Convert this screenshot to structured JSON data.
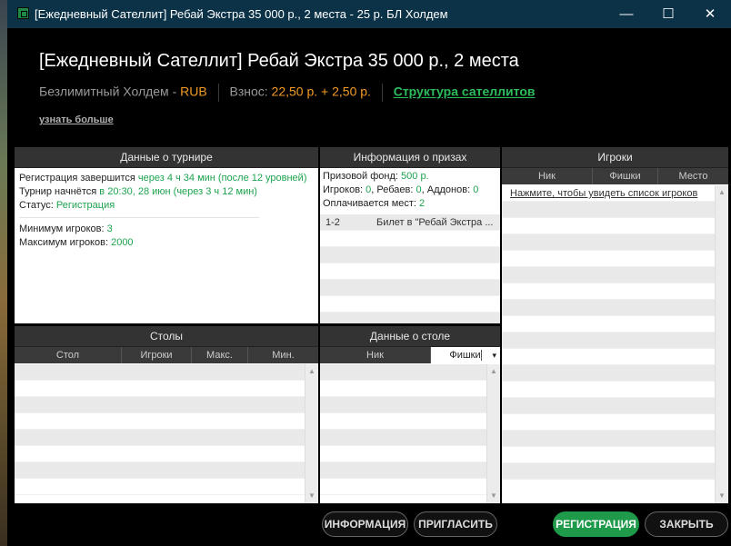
{
  "window": {
    "title": "[Ежедневный Сателлит] Ребай Экстра 35 000 р., 2 места - 25 р. БЛ Холдем",
    "minimize": "—",
    "maximize": "☐",
    "close": "✕"
  },
  "header": {
    "title": "[Ежедневный Сателлит] Ребай Экстра 35 000 р., 2 места",
    "game_type": "Безлимитный Холдем - ",
    "currency": "RUB",
    "fee_label": "Взнос: ",
    "fee_value": "22,50 р. + 2,50 р.",
    "structure_link": "Структура сателлитов",
    "learn_more": "узнать больше"
  },
  "tournament": {
    "header": "Данные о турнире",
    "reg_ends_label": "Регистрация завершится ",
    "reg_ends_value": "через 4 ч 34 мин (после 12 уровней)",
    "starts_label": "Турнир начнётся ",
    "starts_value": "в 20:30, 28 июн (через 3 ч 12 мин)",
    "status_label": "Статус: ",
    "status_value": "Регистрация",
    "min_players_label": "Минимум игроков: ",
    "min_players_value": "3",
    "max_players_label": "Максимум игроков: ",
    "max_players_value": "2000"
  },
  "prizes": {
    "header": "Информация о призах",
    "fund_label": "Призовой фонд: ",
    "fund_value": "500 р.",
    "players_label": "Игроков: ",
    "players_value": "0",
    "rebuys_label": ", Ребаев: ",
    "rebuys_value": "0",
    "addons_label": ", Аддонов: ",
    "addons_value": "0",
    "paid_label": "Оплачивается мест: ",
    "paid_value": "2",
    "rows": [
      {
        "place": "1-2",
        "prize": "Билет в \"Ребай Экстра ..."
      }
    ]
  },
  "players": {
    "header": "Игроки",
    "col_nick": "Ник",
    "col_chips": "Фишки",
    "col_place": "Место",
    "show_list": "Нажмите, чтобы увидеть список игроков"
  },
  "tables": {
    "header": "Столы",
    "col_table": "Стол",
    "col_players": "Игроки",
    "col_max": "Макс.",
    "col_min": "Мин."
  },
  "table_data": {
    "header": "Данные о столе",
    "col_nick": "Ник",
    "col_chips": "Фишки",
    "sort_arrow": "▾"
  },
  "buttons": {
    "info": "ИНФОРМАЦИЯ",
    "invite": "ПРИГЛАСИТЬ",
    "register": "РЕГИСТРАЦИЯ",
    "close": "ЗАКРЫТЬ"
  },
  "colors": {
    "accent_green": "#1e9a4a",
    "orange": "#f29a25",
    "title_bar": "#0c3247"
  }
}
